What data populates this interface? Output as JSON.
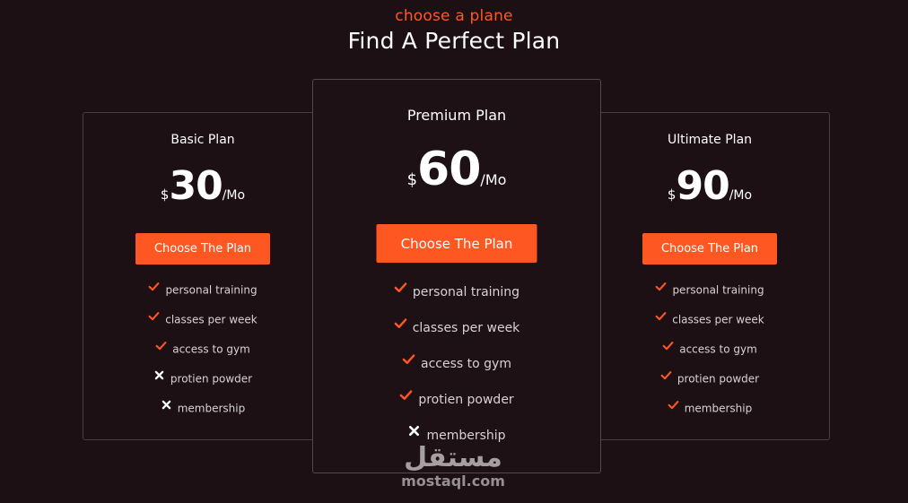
{
  "header": {
    "kicker": "choose a plane",
    "title": "Find A Perfect Plan"
  },
  "plans": [
    {
      "name": "Basic Plan",
      "currency": "$",
      "price": "30",
      "period": "/Mo",
      "cta": "Choose The Plan",
      "features": [
        {
          "label": "personal training",
          "included": true
        },
        {
          "label": "classes per week",
          "included": true
        },
        {
          "label": "access to gym",
          "included": true
        },
        {
          "label": "protien powder",
          "included": false
        },
        {
          "label": "membership",
          "included": false
        }
      ]
    },
    {
      "name": "Premium Plan",
      "currency": "$",
      "price": "60",
      "period": "/Mo",
      "cta": "Choose The Plan",
      "features": [
        {
          "label": "personal training",
          "included": true
        },
        {
          "label": "classes per week",
          "included": true
        },
        {
          "label": "access to gym",
          "included": true
        },
        {
          "label": "protien powder",
          "included": true
        },
        {
          "label": "membership",
          "included": false
        }
      ]
    },
    {
      "name": "Ultimate Plan",
      "currency": "$",
      "price": "90",
      "period": "/Mo",
      "cta": "Choose The Plan",
      "features": [
        {
          "label": "personal training",
          "included": true
        },
        {
          "label": "classes per week",
          "included": true
        },
        {
          "label": "access to gym",
          "included": true
        },
        {
          "label": "protien powder",
          "included": true
        },
        {
          "label": "membership",
          "included": true
        }
      ]
    }
  ],
  "icons": {
    "included": "check-icon",
    "excluded": "x-icon"
  },
  "watermark": {
    "arabic": "مستقل",
    "domain": "mostaql.com"
  },
  "colors": {
    "background": "#1d1014",
    "accent": "#ff5722",
    "text": "#ffffff",
    "muted_text": "#d8d2d4",
    "border": "#4a3c40"
  }
}
